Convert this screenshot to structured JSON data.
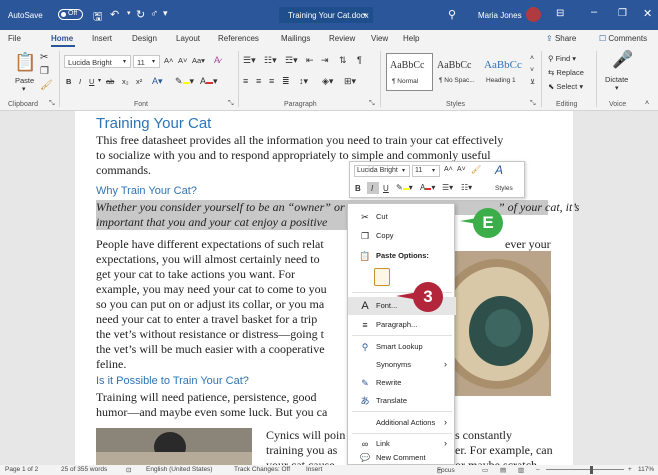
{
  "titlebar": {
    "autosave": "AutoSave",
    "autosave_state": "Off",
    "doc_title": "Training Your Cat.docx",
    "user": "Maria Jones"
  },
  "tabs": [
    "File",
    "Home",
    "Insert",
    "Design",
    "Layout",
    "References",
    "Mailings",
    "Review",
    "View",
    "Help"
  ],
  "share": "Share",
  "comments": "Comments",
  "ribbon": {
    "paste": "Paste",
    "font_name": "Lucida Bright",
    "font_size": "11",
    "styles": [
      {
        "sample": "AaBbCc",
        "name": "¶ Normal"
      },
      {
        "sample": "AaBbCc",
        "name": "¶ No Spac..."
      },
      {
        "sample": "AaBbCc",
        "name": "Heading 1"
      }
    ],
    "find": "Find",
    "replace": "Replace",
    "select": "Select",
    "dictate": "Dictate",
    "groups": {
      "clipboard": "Clipboard",
      "font": "Font",
      "paragraph": "Paragraph",
      "styles": "Styles",
      "editing": "Editing",
      "voice": "Voice"
    }
  },
  "document": {
    "title": "Training Your Cat",
    "intro": [
      "This free datasheet provides all the information you need to train your cat effectively",
      "to socialize with you and to respond appropriately to simple and commonly useful",
      "commands."
    ],
    "h_why": "Why Train Your Cat?",
    "sel1a": "Whether you consider yourself to be an “owner” or a “",
    "sel1b": "” of your cat, it’s",
    "sel2": "important that you and your cat enjoy a positive",
    "body": [
      "People have different expectations of such relat",
      "expectations, you will almost certainly need to",
      "get your cat to take actions you want. For",
      "example, you may need your cat to come to you",
      "so you can put on or adjust its collar, or you ma",
      "need your cat to enter a travel basket for a trip",
      "the vet’s without resistance or distress—going t",
      "the vet’s will be much easier with a cooperative",
      "feline."
    ],
    "body_right": "ever your",
    "h_possible": "Is it Possible to Train Your Cat?",
    "p2": [
      "Training will need patience, persistence, good",
      "humor—and maybe even some luck. But you ca"
    ],
    "p3": [
      "Cynics will poin",
      "training you as",
      "your cat cause"
    ],
    "p3_right": [
      "s constantly",
      "er. For example, can",
      "or maybe scratch"
    ]
  },
  "minitoolbar": {
    "font": "Lucida Bright",
    "size": "11",
    "styles": "Styles"
  },
  "context_menu": [
    {
      "icon": "cut-icon",
      "label": "Cut",
      "glyph": "✂"
    },
    {
      "icon": "copy-icon",
      "label": "Copy",
      "glyph": "❐"
    },
    {
      "icon": "paste-icon",
      "label": "Paste Options:",
      "glyph": "📋"
    },
    {
      "icon": "font-icon",
      "label": "Font...",
      "glyph": "A"
    },
    {
      "icon": "paragraph-icon",
      "label": "Paragraph...",
      "glyph": "≡"
    },
    {
      "icon": "smart-lookup-icon",
      "label": "Smart Lookup",
      "glyph": "⚲"
    },
    {
      "icon": "synonyms-icon",
      "label": "Synonyms",
      "glyph": ""
    },
    {
      "icon": "rewrite-icon",
      "label": "Rewrite",
      "glyph": "✎"
    },
    {
      "icon": "translate-icon",
      "label": "Translate",
      "glyph": "あ"
    },
    {
      "icon": "additional-actions-icon",
      "label": "Additional Actions",
      "glyph": ""
    },
    {
      "icon": "link-icon",
      "label": "Link",
      "glyph": "∞"
    },
    {
      "icon": "new-comment-icon",
      "label": "New Comment",
      "glyph": "💬"
    }
  ],
  "callouts": {
    "e": "E",
    "three": "3"
  },
  "statusbar": {
    "page": "Page 1 of 2",
    "words": "25 of 355 words",
    "language": "English (United States)",
    "track": "Track Changes: Off",
    "insert": "Insert",
    "focus": "Focus",
    "zoom": "117%"
  },
  "colors": {
    "accent": "#2b579a",
    "heading": "#2e74b5",
    "callout_green": "#3cae49",
    "callout_red": "#b3253a"
  }
}
